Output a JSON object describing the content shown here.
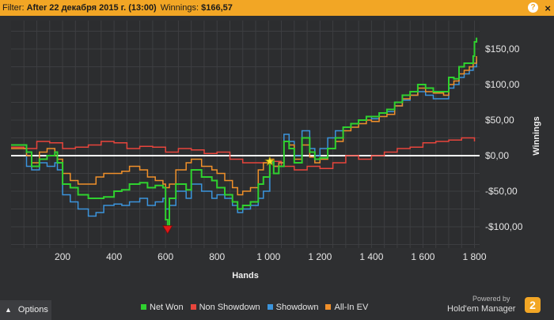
{
  "filter": {
    "label": "Filter:",
    "value": "After 22 декабря 2015 г. (13:00)",
    "winnings_label": "Winnings:",
    "winnings_value": "$166,57",
    "help_glyph": "?",
    "close_glyph": "×"
  },
  "options_label": "Options",
  "powered_by": "Powered by",
  "brand": "Hold'em Manager",
  "brand_logo": "2",
  "chart_data": {
    "type": "line",
    "title": "",
    "xlabel": "Hands",
    "ylabel": "Winnings",
    "xlim": [
      0,
      1820
    ],
    "ylim": [
      -130,
      190
    ],
    "xticks": [
      200,
      400,
      600,
      800,
      1000,
      1200,
      1400,
      1600,
      1800
    ],
    "xtick_labels": [
      "200",
      "400",
      "600",
      "800",
      "1 000",
      "1 200",
      "1 400",
      "1 600",
      "1 800"
    ],
    "yticks": [
      150,
      100,
      50,
      0,
      -50,
      -100
    ],
    "ytick_labels": [
      "$150,00",
      "$100,00",
      "$50,00",
      "$0,00",
      "-$50,00",
      "-$100,00"
    ],
    "grid": true,
    "legend_position": "bottom",
    "markers": [
      {
        "name": "max",
        "x": 1005,
        "y": -8,
        "color": "#f5e325"
      },
      {
        "name": "min",
        "x": 608,
        "y": -103,
        "color": "#e01818"
      }
    ],
    "series": [
      {
        "name": "Net Won",
        "color": "#2fd12f",
        "x": [
          0,
          55,
          60,
          80,
          110,
          140,
          170,
          180,
          200,
          230,
          260,
          300,
          330,
          360,
          400,
          430,
          460,
          500,
          530,
          560,
          590,
          600,
          608,
          615,
          640,
          680,
          700,
          740,
          780,
          800,
          830,
          860,
          880,
          900,
          930,
          960,
          980,
          1005,
          1020,
          1040,
          1060,
          1080,
          1100,
          1130,
          1160,
          1180,
          1200,
          1230,
          1260,
          1290,
          1320,
          1350,
          1380,
          1400,
          1430,
          1460,
          1490,
          1520,
          1550,
          1580,
          1610,
          1640,
          1680,
          1700,
          1720,
          1740,
          1760,
          1780,
          1795,
          1800,
          1808
        ],
        "y": [
          15,
          15,
          5,
          -15,
          -5,
          0,
          5,
          -10,
          -40,
          -45,
          -55,
          -60,
          -60,
          -58,
          -50,
          -48,
          -40,
          -38,
          -45,
          -42,
          -45,
          -90,
          -103,
          -60,
          -40,
          -48,
          -20,
          -30,
          -35,
          -45,
          -55,
          -65,
          -75,
          -70,
          -65,
          -40,
          -30,
          -8,
          -25,
          -15,
          20,
          10,
          -10,
          25,
          5,
          -5,
          -3,
          10,
          25,
          40,
          45,
          50,
          55,
          55,
          60,
          65,
          75,
          85,
          90,
          100,
          95,
          90,
          90,
          110,
          108,
          125,
          130,
          130,
          140,
          160,
          166
        ]
      },
      {
        "name": "Non Showdown",
        "color": "#e8453c",
        "x": [
          0,
          50,
          100,
          150,
          200,
          250,
          300,
          350,
          400,
          450,
          500,
          550,
          600,
          650,
          700,
          750,
          800,
          850,
          900,
          950,
          1000,
          1050,
          1100,
          1150,
          1200,
          1250,
          1300,
          1350,
          1400,
          1450,
          1500,
          1550,
          1600,
          1650,
          1700,
          1750,
          1800
        ],
        "y": [
          12,
          10,
          20,
          18,
          10,
          12,
          15,
          20,
          18,
          10,
          13,
          12,
          5,
          10,
          8,
          3,
          5,
          -5,
          -10,
          -10,
          -8,
          -15,
          -20,
          -15,
          -18,
          -10,
          0,
          -5,
          0,
          5,
          10,
          12,
          18,
          20,
          22,
          25,
          20
        ]
      },
      {
        "name": "Showdown",
        "color": "#3b94dc",
        "x": [
          0,
          55,
          60,
          80,
          110,
          140,
          170,
          180,
          200,
          230,
          260,
          300,
          330,
          360,
          400,
          430,
          460,
          500,
          530,
          560,
          590,
          600,
          615,
          640,
          680,
          700,
          740,
          780,
          800,
          830,
          860,
          880,
          900,
          930,
          960,
          980,
          1005,
          1020,
          1040,
          1060,
          1080,
          1100,
          1130,
          1160,
          1180,
          1200,
          1230,
          1260,
          1290,
          1320,
          1350,
          1380,
          1400,
          1430,
          1460,
          1490,
          1520,
          1550,
          1580,
          1610,
          1640,
          1680,
          1700,
          1720,
          1740,
          1760,
          1780,
          1795,
          1808
        ],
        "y": [
          15,
          15,
          -15,
          -20,
          -10,
          -15,
          -10,
          -20,
          -55,
          -65,
          -75,
          -85,
          -80,
          -70,
          -68,
          -70,
          -65,
          -60,
          -70,
          -65,
          -60,
          -75,
          -70,
          -50,
          -60,
          -40,
          -50,
          -60,
          -55,
          -60,
          -70,
          -80,
          -75,
          -70,
          -60,
          -50,
          -10,
          -15,
          -10,
          30,
          20,
          0,
          35,
          10,
          0,
          10,
          25,
          35,
          40,
          45,
          50,
          55,
          52,
          60,
          62,
          70,
          78,
          85,
          90,
          85,
          80,
          80,
          95,
          100,
          110,
          115,
          120,
          125,
          135
        ]
      },
      {
        "name": "All-In EV",
        "color": "#f0902a",
        "x": [
          0,
          55,
          60,
          80,
          110,
          140,
          170,
          180,
          200,
          230,
          260,
          300,
          330,
          360,
          400,
          430,
          460,
          500,
          530,
          560,
          590,
          600,
          615,
          640,
          680,
          700,
          740,
          780,
          800,
          830,
          860,
          880,
          900,
          930,
          960,
          980,
          1005,
          1020,
          1040,
          1060,
          1080,
          1100,
          1130,
          1160,
          1180,
          1200,
          1230,
          1260,
          1290,
          1320,
          1350,
          1380,
          1400,
          1430,
          1460,
          1490,
          1520,
          1550,
          1580,
          1610,
          1640,
          1680,
          1700,
          1720,
          1740,
          1760,
          1780,
          1795,
          1808
        ],
        "y": [
          10,
          10,
          0,
          -10,
          5,
          10,
          0,
          -5,
          -25,
          -35,
          -40,
          -40,
          -30,
          -25,
          -25,
          -22,
          -15,
          -20,
          -30,
          -35,
          -40,
          -45,
          -40,
          -20,
          -10,
          -5,
          -15,
          -20,
          -25,
          -35,
          -45,
          -55,
          -50,
          -45,
          -20,
          -10,
          -5,
          -15,
          -10,
          20,
          15,
          -5,
          15,
          -2,
          -10,
          -5,
          10,
          20,
          35,
          40,
          45,
          50,
          48,
          55,
          58,
          70,
          80,
          85,
          95,
          90,
          88,
          85,
          100,
          105,
          115,
          120,
          125,
          130,
          140
        ]
      }
    ]
  }
}
